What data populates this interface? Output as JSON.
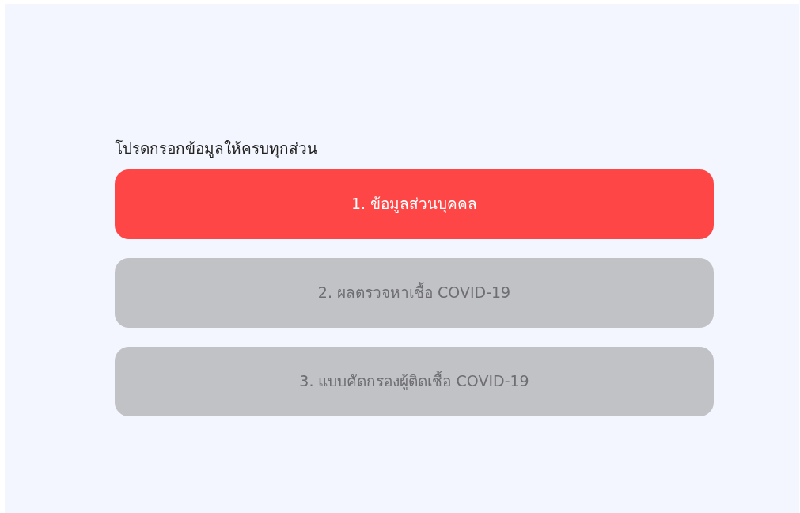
{
  "heading": "โปรดกรอกข้อมูลให้ครบทุกส่วน",
  "steps": [
    {
      "label": "1. ข้อมูลส่วนบุคคล",
      "active": true
    },
    {
      "label": "2. ผลตรวจหาเชื้อ COVID-19",
      "active": false
    },
    {
      "label": "3. แบบคัดกรองผู้ติดเชื้อ COVID-19",
      "active": false
    }
  ]
}
